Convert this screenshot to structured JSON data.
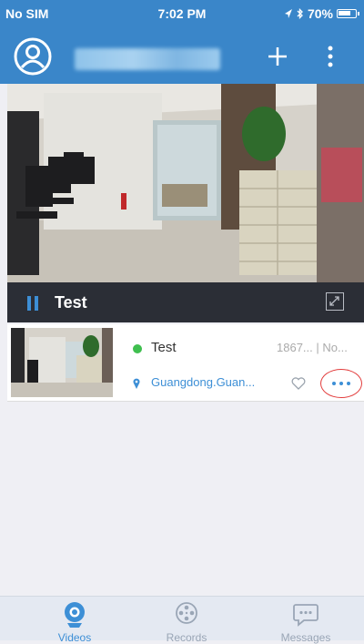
{
  "status_bar": {
    "carrier": "No SIM",
    "time": "7:02 PM",
    "battery": "70%"
  },
  "header": {
    "avatar_icon": "user-circle-icon",
    "add_icon": "plus-icon",
    "more_icon": "vertical-ellipsis-icon",
    "username_blurred": true
  },
  "player": {
    "title": "Test",
    "state_icon": "pause-icon",
    "fullscreen_icon": "expand-icon"
  },
  "device": {
    "name": "Test",
    "id_text": "1867... | No...",
    "location": "Guangdong.Guan...",
    "status": "online",
    "status_color": "#3fbf4f"
  },
  "tabs": [
    {
      "label": "Videos",
      "icon": "camera-icon",
      "active": true
    },
    {
      "label": "Records",
      "icon": "film-reel-icon",
      "active": false
    },
    {
      "label": "Messages",
      "icon": "chat-bubble-icon",
      "active": false
    }
  ],
  "colors": {
    "brand": "#3a86c9",
    "accent": "#3d8fd6",
    "highlight_circle": "#e23b3b"
  }
}
